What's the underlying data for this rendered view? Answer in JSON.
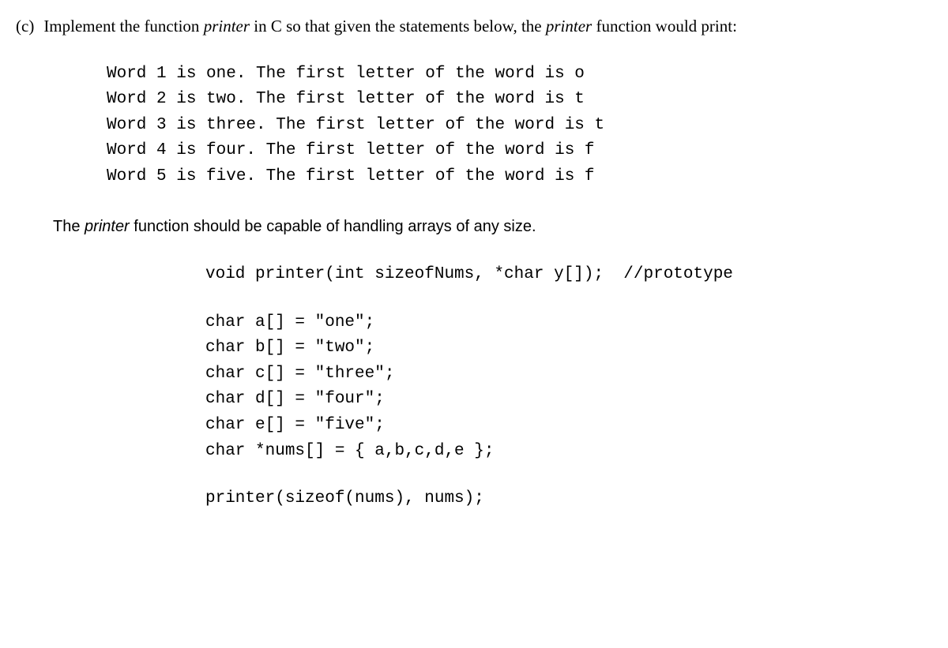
{
  "question": {
    "label": "(c)",
    "text_before_printer1": "Implement the function ",
    "printer1": "printer",
    "text_after_printer1": " in C so that given the statements below, the ",
    "printer2": "printer",
    "text_after_printer2": " function would print:"
  },
  "output": {
    "line1": "Word 1 is one. The first letter of the word is o",
    "line2": "Word 2 is two. The first letter of the word is t",
    "line3": "Word 3 is three. The first letter of the word is t",
    "line4": "Word 4 is four. The first letter of the word is f",
    "line5": "Word 5 is five. The first letter of the word is f"
  },
  "instruction": {
    "before": "The ",
    "printer": "printer",
    "after": " function should be capable of handling arrays of any size."
  },
  "code": {
    "prototype": "void printer(int sizeofNums, *char y[]);  //prototype",
    "decl1": "char a[] = \"one\";",
    "decl2": "char b[] = \"two\";",
    "decl3": "char c[] = \"three\";",
    "decl4": "char d[] = \"four\";",
    "decl5": "char e[] = \"five\";",
    "decl6": "char *nums[] = { a,b,c,d,e };",
    "call": "printer(sizeof(nums), nums);"
  }
}
